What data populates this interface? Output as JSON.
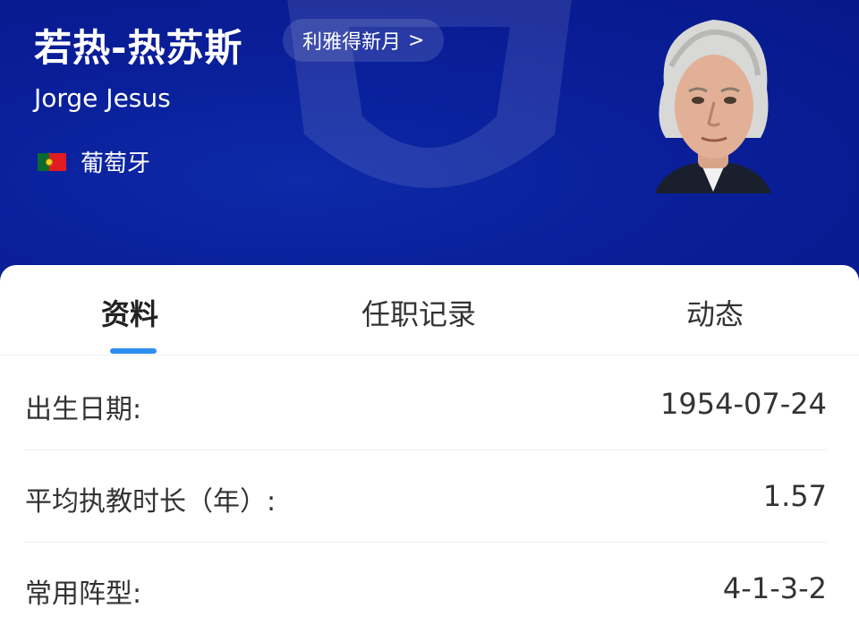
{
  "coach": {
    "name_zh": "若热-热苏斯",
    "club": "利雅得新月",
    "club_chevron": ">",
    "name_en": "Jorge Jesus",
    "country": "葡萄牙",
    "flag_icon": "portugal-flag-icon"
  },
  "colors": {
    "header_bg": "#0a1f9a",
    "accent": "#2d8ff0",
    "text": "#333333"
  },
  "tabs": [
    {
      "label": "资料",
      "active": true
    },
    {
      "label": "任职记录",
      "active": false
    },
    {
      "label": "动态",
      "active": false
    }
  ],
  "info": [
    {
      "label": "出生日期:",
      "value": "1954-07-24"
    },
    {
      "label": "平均执教时长（年）:",
      "value": "1.57"
    },
    {
      "label": "常用阵型:",
      "value": "4-1-3-2"
    }
  ]
}
